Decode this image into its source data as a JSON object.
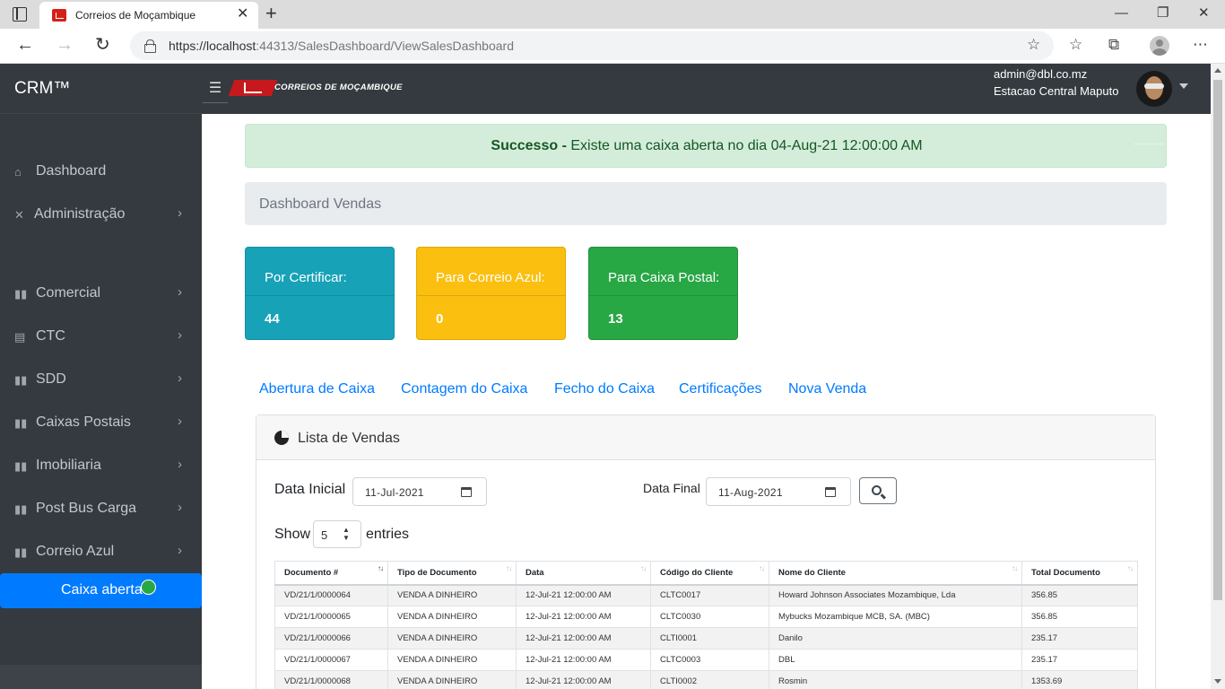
{
  "browser": {
    "tab_title": "Correios de Moçambique",
    "url_host": "https://localhost",
    "url_rest": ":44313/SalesDashboard/ViewSalesDashboard"
  },
  "header": {
    "brand": "CRM™",
    "logo_text": "CORREIOS DE MOÇAMBIQUE",
    "user_email": "admin@dbl.co.mz",
    "user_station": "Estacao Central Maputo"
  },
  "sidebar": {
    "items": [
      {
        "label": "Dashboard",
        "icon": "home-icon"
      },
      {
        "label": "Administração",
        "icon": "tools-icon"
      },
      {
        "label": "Comercial",
        "icon": "book-icon"
      },
      {
        "label": "CTC",
        "icon": "id-card-icon"
      },
      {
        "label": "SDD",
        "icon": "book-icon"
      },
      {
        "label": "Caixas Postais",
        "icon": "book-icon"
      },
      {
        "label": "Imobiliaria",
        "icon": "book-icon"
      },
      {
        "label": "Post Bus Carga",
        "icon": "book-icon"
      },
      {
        "label": "Correio Azul",
        "icon": "book-icon"
      }
    ],
    "caixa_label": "Caixa aberta"
  },
  "alert": {
    "strong": "Successo -",
    "message": "Existe uma caixa aberta no dia 04-Aug-21 12:00:00 AM"
  },
  "page_title": "Dashboard Vendas",
  "stats": [
    {
      "title": "Por Certificar:",
      "value": "44",
      "color": "#17a2b8"
    },
    {
      "title": "Para Correio Azul:",
      "value": "0",
      "color": "#ffc107"
    },
    {
      "title": "Para Caixa Postal:",
      "value": "13",
      "color": "#28a745"
    }
  ],
  "actions": [
    "Abertura de Caixa",
    "Contagem do Caixa",
    "Fecho do Caixa",
    "Certificações",
    "Nova Venda"
  ],
  "sales": {
    "title": "Lista de Vendas",
    "start_label": "Data Inicial",
    "start_value": "11-Jul-2021",
    "end_label": "Data Final",
    "end_value": "11-Aug-2021",
    "show_label": "Show",
    "entries_value": "5",
    "entries_label": "entries",
    "columns": [
      "Documento #",
      "Tipo de Documento",
      "Data",
      "Código do Cliente",
      "Nome do Cliente",
      "Total Documento"
    ],
    "rows": [
      [
        "VD/21/1/0000064",
        "VENDA A DINHEIRO",
        "12-Jul-21 12:00:00 AM",
        "CLTC0017",
        "Howard Johnson Associates Mozambique, Lda",
        "356.85"
      ],
      [
        "VD/21/1/0000065",
        "VENDA A DINHEIRO",
        "12-Jul-21 12:00:00 AM",
        "CLTC0030",
        "Mybucks Mozambique MCB, SA. (MBC)",
        "356.85"
      ],
      [
        "VD/21/1/0000066",
        "VENDA A DINHEIRO",
        "12-Jul-21 12:00:00 AM",
        "CLTI0001",
        "Danilo",
        "235.17"
      ],
      [
        "VD/21/1/0000067",
        "VENDA A DINHEIRO",
        "12-Jul-21 12:00:00 AM",
        "CLTC0003",
        "DBL",
        "235.17"
      ],
      [
        "VD/21/1/0000068",
        "VENDA A DINHEIRO",
        "12-Jul-21 12:00:00 AM",
        "CLTI0002",
        "Rosmin",
        "1353.69"
      ]
    ]
  }
}
